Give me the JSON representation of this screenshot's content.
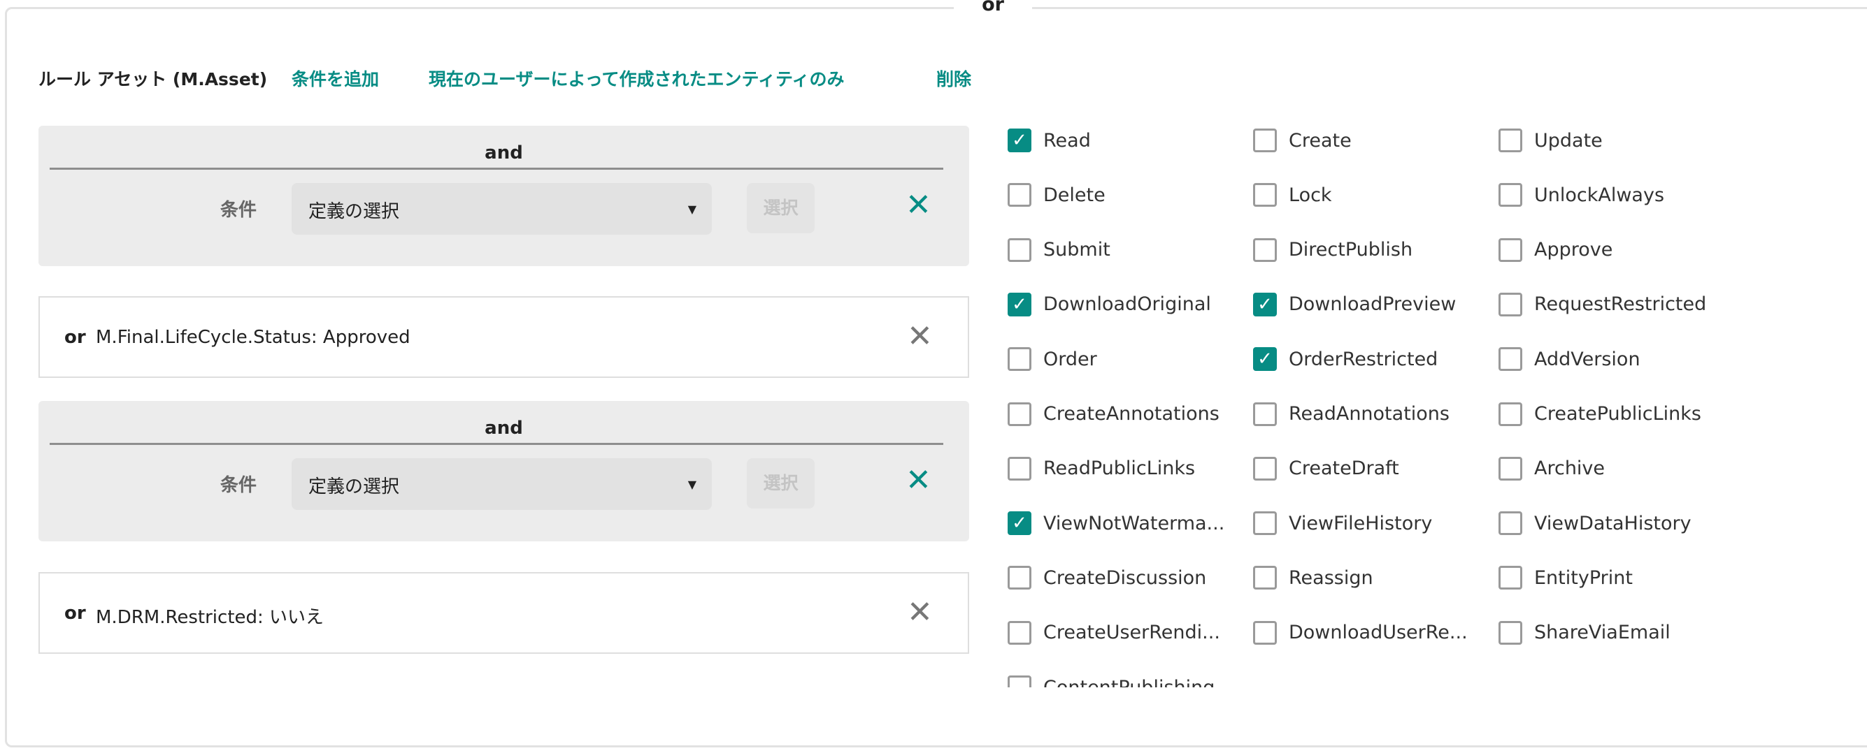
{
  "top_label": "or",
  "header": {
    "title": "ルール アセット (M.Asset)",
    "add_condition": "条件を追加",
    "created_by_current_user": "現在のユーザーによって作成されたエンティティのみ",
    "delete": "削除"
  },
  "groups": [
    {
      "op": "and",
      "condition_label": "条件",
      "select_value": "定義の選択",
      "select_button": "選択"
    },
    {
      "op": "and",
      "condition_label": "条件",
      "select_value": "定義の選択",
      "select_button": "選択"
    }
  ],
  "rows": [
    {
      "op": "or",
      "text": "M.Final.LifeCycle.Status: Approved"
    },
    {
      "op": "or",
      "text": "M.DRM.Restricted: いいえ"
    }
  ],
  "accent_color": "#078c84",
  "permissions": [
    {
      "label": "Read",
      "checked": true
    },
    {
      "label": "Create",
      "checked": false
    },
    {
      "label": "Update",
      "checked": false
    },
    {
      "label": "Delete",
      "checked": false
    },
    {
      "label": "Lock",
      "checked": false
    },
    {
      "label": "UnlockAlways",
      "checked": false
    },
    {
      "label": "Submit",
      "checked": false
    },
    {
      "label": "DirectPublish",
      "checked": false
    },
    {
      "label": "Approve",
      "checked": false
    },
    {
      "label": "DownloadOriginal",
      "checked": true
    },
    {
      "label": "DownloadPreview",
      "checked": true
    },
    {
      "label": "RequestRestricted",
      "checked": false
    },
    {
      "label": "Order",
      "checked": false
    },
    {
      "label": "OrderRestricted",
      "checked": true
    },
    {
      "label": "AddVersion",
      "checked": false
    },
    {
      "label": "CreateAnnotations",
      "checked": false
    },
    {
      "label": "ReadAnnotations",
      "checked": false
    },
    {
      "label": "CreatePublicLinks",
      "checked": false
    },
    {
      "label": "ReadPublicLinks",
      "checked": false
    },
    {
      "label": "CreateDraft",
      "checked": false
    },
    {
      "label": "Archive",
      "checked": false
    },
    {
      "label": "ViewNotWaterma...",
      "checked": true
    },
    {
      "label": "ViewFileHistory",
      "checked": false
    },
    {
      "label": "ViewDataHistory",
      "checked": false
    },
    {
      "label": "CreateDiscussion",
      "checked": false
    },
    {
      "label": "Reassign",
      "checked": false
    },
    {
      "label": "EntityPrint",
      "checked": false
    },
    {
      "label": "CreateUserRendi...",
      "checked": false
    },
    {
      "label": "DownloadUserRe...",
      "checked": false
    },
    {
      "label": "ShareViaEmail",
      "checked": false
    },
    {
      "label": "ContentPublishing",
      "checked": false
    }
  ]
}
